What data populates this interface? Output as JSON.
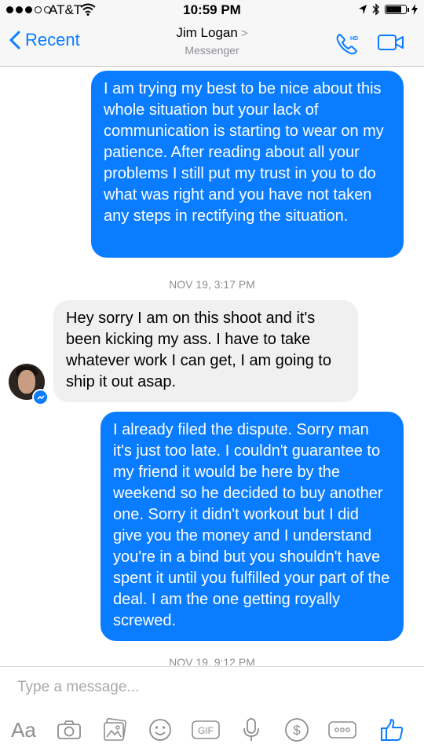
{
  "status_bar": {
    "carrier": "AT&T",
    "time": "10:59 PM",
    "signal_bars_filled": 3,
    "signal_bars_total": 5,
    "battery_level": 0.8
  },
  "header": {
    "back_label": "Recent",
    "contact_name": "Jim Logan",
    "contact_chevron": ">",
    "subtitle": "Messenger",
    "call_badge": "HD",
    "accent_color": "#0a7cff"
  },
  "messages": [
    {
      "direction": "outgoing",
      "text": "I am trying my best to be nice about this whole situation but your lack of communication is starting to wear on my patience. After reading about all your problems I still put my trust in you to do what was right and you have not taken any steps in rectifying the situation."
    },
    {
      "direction": "incoming",
      "text": "Hey sorry I am on this shoot and it's been kicking my ass.  I have to take whatever work I can get, I am going to ship it out asap."
    },
    {
      "direction": "outgoing",
      "text": "I already filed the dispute. Sorry man it's just too late. I couldn't guarantee to my friend it would be here by the weekend so he decided to buy another one. Sorry it didn't workout but I did give you the money and I understand you're in a bind but you shouldn't have spent it until you fulfilled your part of the deal. I am the one getting royally screwed."
    }
  ],
  "timestamps": [
    "NOV 19, 3:17 PM",
    "NOV 19, 9:12 PM"
  ],
  "composer": {
    "placeholder": "Type a message...",
    "value": "",
    "text_style_label": "Aa",
    "gif_label": "GIF",
    "tools": [
      "text-style-icon",
      "camera-icon",
      "gallery-icon",
      "emoji-icon",
      "gif-icon",
      "microphone-icon",
      "payment-icon",
      "more-icon",
      "like-icon"
    ]
  }
}
